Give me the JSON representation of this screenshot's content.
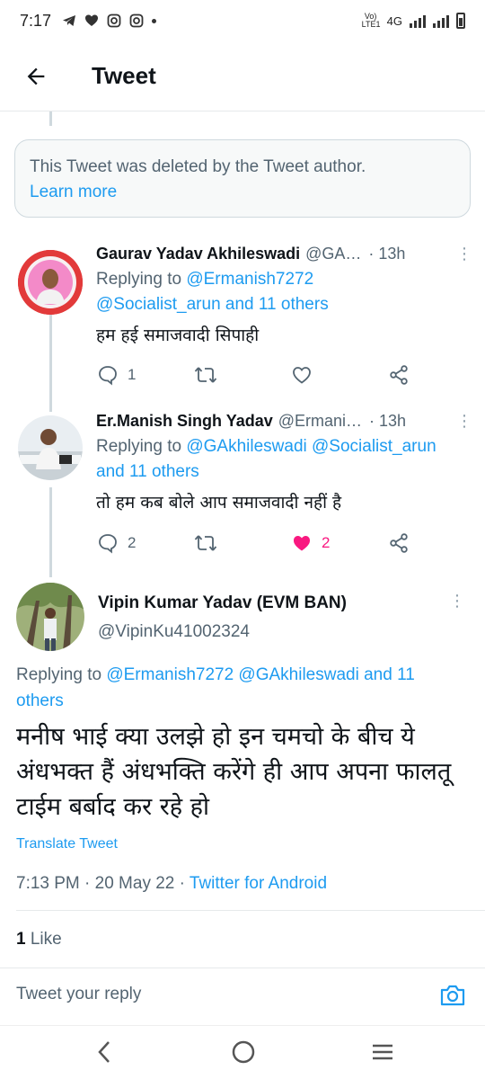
{
  "status_bar": {
    "time": "7:17",
    "network": "4G",
    "volte": "Vo) LTE1"
  },
  "header": {
    "title": "Tweet"
  },
  "deleted_notice": {
    "text": "This Tweet was deleted by the Tweet author.",
    "link": "Learn more"
  },
  "replies": [
    {
      "name": "Gaurav Yadav Akhileswadi",
      "handle": "@GA…",
      "time": "· 13h",
      "replying_prefix": "Replying to",
      "replying_line1": "@Ermanish7272",
      "replying_line2": "@Socialist_arun and 11 others",
      "text": "हम हई समाजवादी सिपाही",
      "reply_count": "1",
      "like_count": ""
    },
    {
      "name": "Er.Manish Singh Yadav",
      "handle": "@Ermani…",
      "time": "· 13h",
      "replying_prefix": "Replying to",
      "replying_line1": "@GAkhileswadi @Socialist_arun",
      "replying_line2": "and 11 others",
      "text": "तो हम कब बोले आप समाजवादी नहीं है",
      "reply_count": "2",
      "like_count": "2"
    }
  ],
  "main_tweet": {
    "name": "Vipin Kumar Yadav (EVM BAN)",
    "handle": "@VipinKu41002324",
    "replying_prefix": "Replying to",
    "replying_mentions": "@Ermanish7272 @GAkhileswadi and 11 others",
    "text": "मनीष भाई क्या उलझे हो इन चमचो के बीच ये अंधभक्त हैं अंधभक्ति करेंगे ही आप अपना फालतू टाईम बर्बाद कर रहे हो",
    "translate_label": "Translate Tweet",
    "timestamp": "7:13 PM · 20 May 22 ·",
    "source": "Twitter for Android",
    "like_count": "1",
    "like_label": "Like"
  },
  "composer": {
    "placeholder": "Tweet your reply"
  },
  "colors": {
    "accent": "#1d9bf0",
    "like": "#f91880",
    "muted": "#536471"
  }
}
